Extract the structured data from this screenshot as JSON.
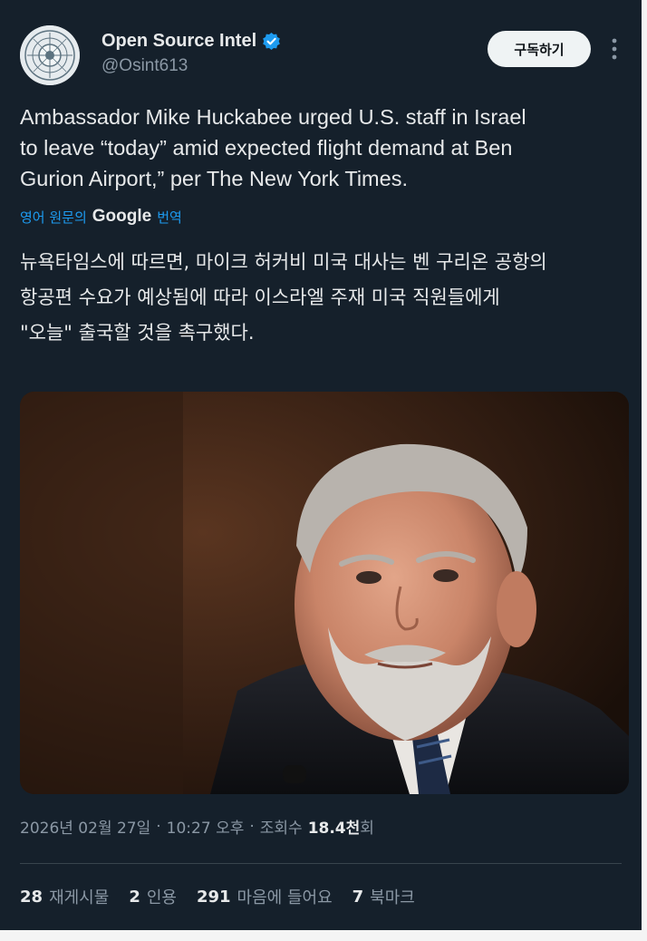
{
  "author": {
    "name": "Open Source Intel",
    "handle": "@Osint613"
  },
  "subscribe_label": "구독하기",
  "tweet": {
    "text": "Ambassador Mike Huckabee urged U.S. staff in Israel\nto leave “today” amid expected flight demand at Ben\nGurion Airport,” per The New York Times."
  },
  "translation": {
    "prefix": "영어 원문의",
    "provider": "Google",
    "suffix": "번역",
    "text": "뉴욕타임스에 따르면, 마이크 허커비 미국 대사는 벤 구리온 공항의\n항공편 수요가 예상됨에 따라 이스라엘 주재 미국 직원들에게\n\"오늘\" 출국할 것을 촉구했다."
  },
  "meta": {
    "date": "2026년 02월 27일",
    "time": "10:27 오후",
    "views_label": "조회수",
    "views_value": "18.4천",
    "views_suffix": "회"
  },
  "stats": {
    "reposts": {
      "num": "28",
      "label": "재게시물"
    },
    "quotes": {
      "num": "2",
      "label": "인용"
    },
    "likes": {
      "num": "291",
      "label": "마음에 들어요"
    },
    "bookmarks": {
      "num": "7",
      "label": "북마크"
    }
  },
  "colors": {
    "background": "#15202b",
    "accent": "#1d9bf0",
    "secondary_text": "#8b98a5"
  }
}
